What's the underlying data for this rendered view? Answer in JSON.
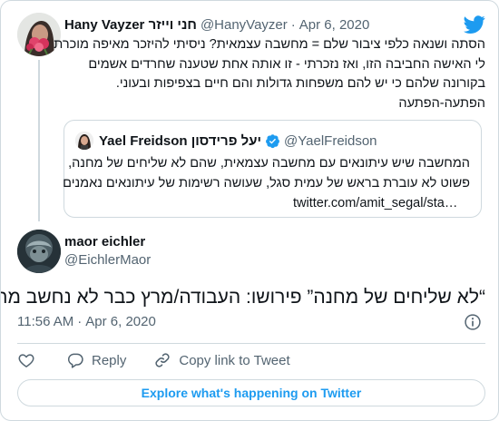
{
  "parent_tweet": {
    "display_name": "Hany Vayzer חני וייזר",
    "handle": "@HanyVayzer",
    "separator": "·",
    "date": "Apr 6, 2020",
    "lines": [
      "הסתה ושנאה כלפי ציבור שלם = מחשבה עצמאית? ניסיתי להיזכר מאיפה מוכרת",
      "לי האישה החביבה הזו, ואז נזכרתי - זו אותה אחת שטענה שחרדים אשמים",
      "בקורונה שלהם כי יש להם משפחות גדולות והם חיים בצפיפות ובעוני.",
      "הפתעה-הפתעה"
    ]
  },
  "quoted_tweet": {
    "display_name": "Yael Freidson יעל פרידסון",
    "handle": "@YaelFreidson",
    "lines": [
      "המחשבה שיש עיתונאים עם מחשבה עצמאית, שהם לא שליחים של מחנה,",
      "פשוט לא עוברת בראש של עמית סגל, שעושה רשימות של עיתונאים נאמנים"
    ],
    "link": "twitter.com/amit_segal/sta…"
  },
  "main_tweet": {
    "display_name": "maor eichler",
    "handle": "@EichlerMaor",
    "text": "“לא שליחים של מחנה” פירושו: העבודה/מרץ כבר לא נחשב מחנה",
    "time": "11:56 AM",
    "separator": "·",
    "date": "Apr 6, 2020"
  },
  "actions": {
    "reply_label": "Reply",
    "copy_link_label": "Copy link to Tweet"
  },
  "explore_label": "Explore what's happening on Twitter",
  "icons": {
    "brand": "twitter-bird-icon",
    "verified": "verified-badge-icon",
    "info": "info-icon",
    "like": "heart-icon",
    "reply": "reply-bubble-icon",
    "copy_link": "link-icon"
  },
  "colors": {
    "brand_blue": "#1d9bf0",
    "text": "#0f1419",
    "muted": "#536471",
    "border": "#cfd9de",
    "like_red": "#f91880"
  }
}
